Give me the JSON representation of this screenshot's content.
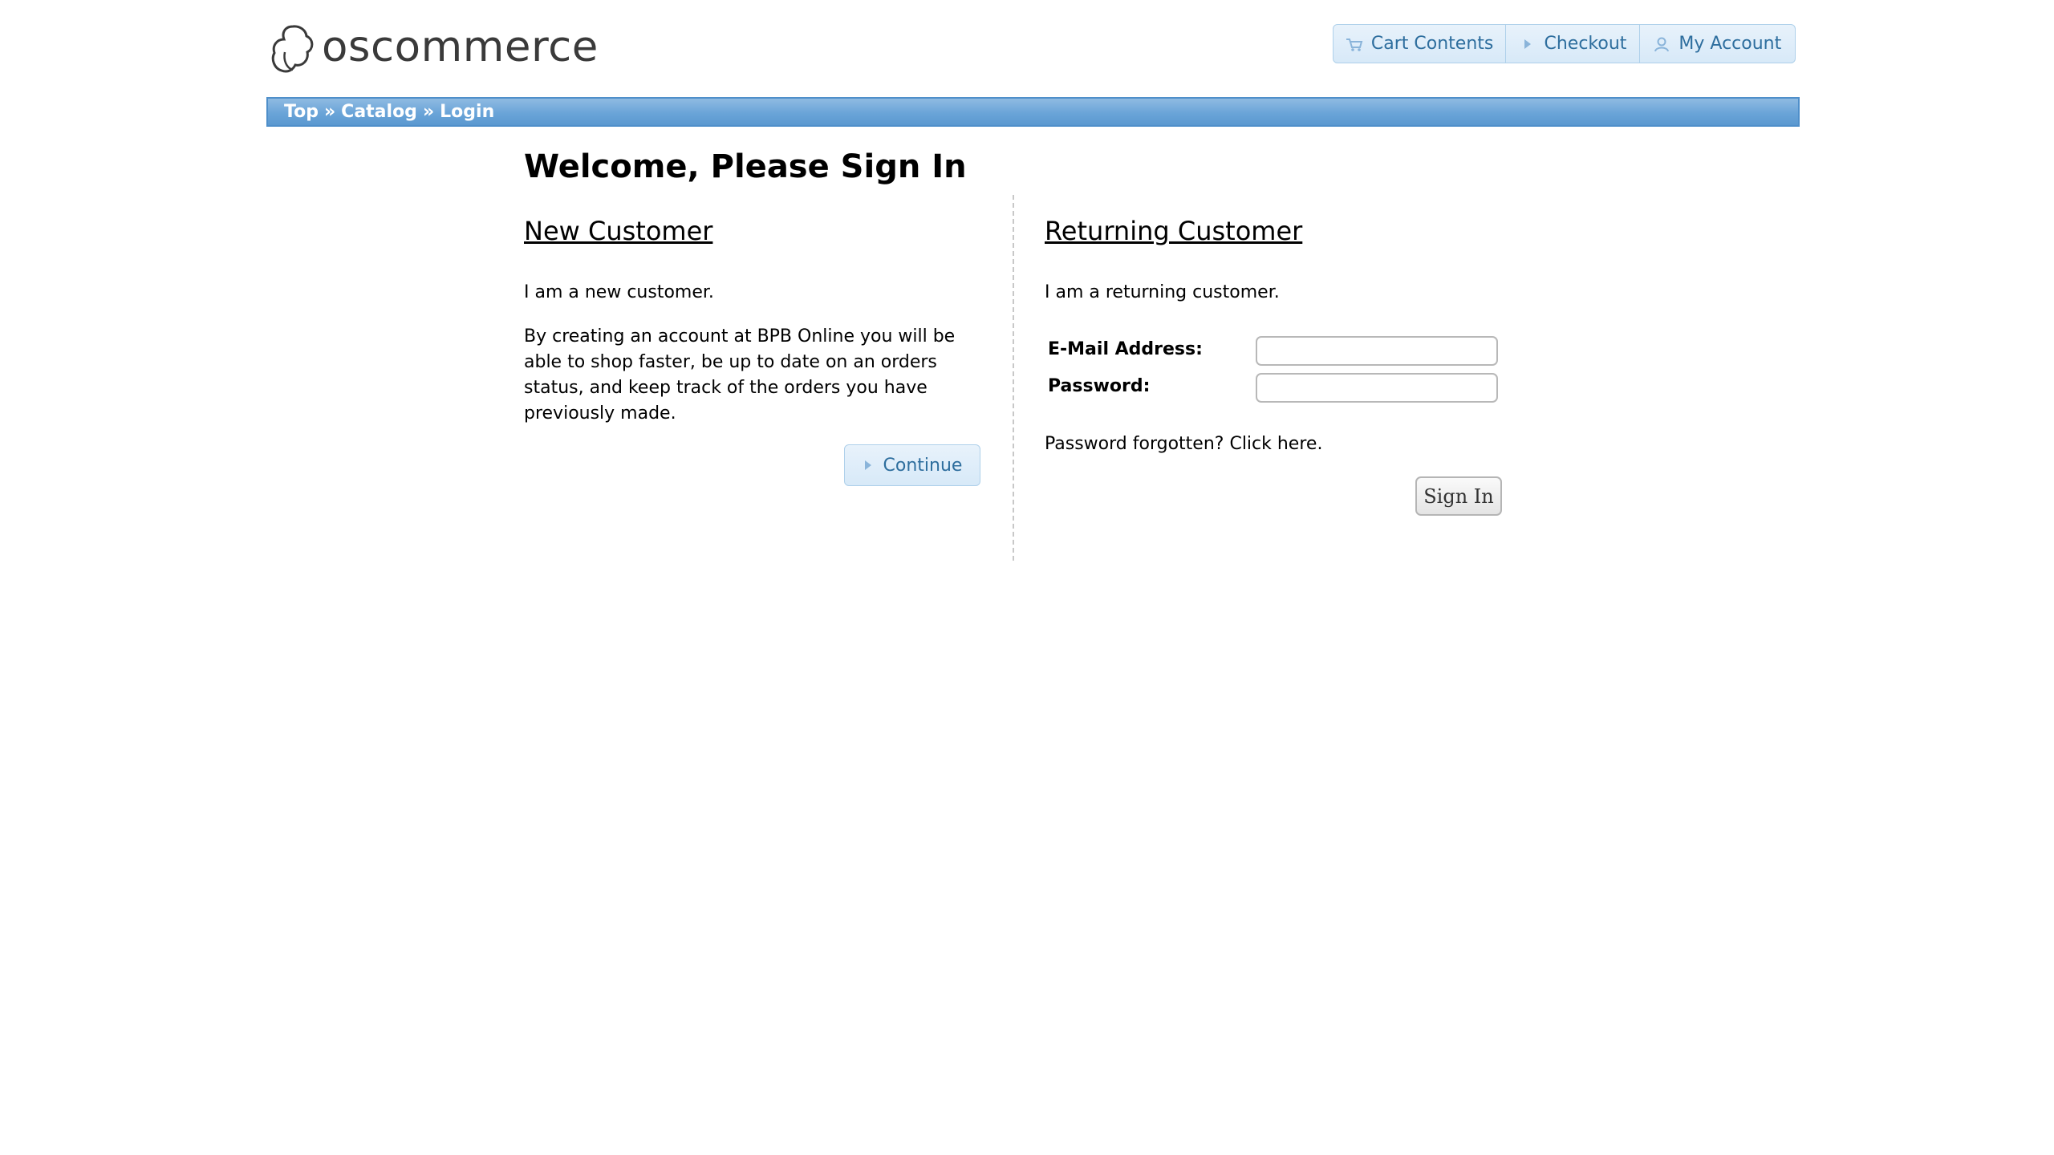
{
  "header": {
    "logo_text": "oscommerce",
    "nav": {
      "cart_label": "Cart Contents",
      "checkout_label": "Checkout",
      "account_label": "My Account"
    }
  },
  "breadcrumb": {
    "items": [
      "Top",
      "Catalog",
      "Login"
    ],
    "separator": "»"
  },
  "main": {
    "title": "Welcome, Please Sign In",
    "new_customer": {
      "heading": "New Customer",
      "intro": "I am a new customer.",
      "description": "By creating an account at BPB Online you will be able to shop faster, be up to date on an orders status, and keep track of the orders you have previously made.",
      "continue_label": "Continue"
    },
    "returning_customer": {
      "heading": "Returning Customer",
      "intro": "I am a returning customer.",
      "email_label": "E-Mail Address:",
      "email_value": "",
      "password_label": "Password:",
      "password_value": "",
      "forgot_text": "Password forgotten?",
      "forgot_link": "Click here.",
      "signin_label": "Sign In"
    }
  },
  "colors": {
    "accent_blue": "#2e6e9e",
    "button_border": "#aed0ea",
    "breadcrumb_bg": "#6aa4d8",
    "breadcrumb_border": "#4f8fca"
  },
  "icons": {
    "cart": "cart-icon",
    "checkout": "triangle-right-icon",
    "account": "person-icon",
    "continue": "triangle-right-icon"
  }
}
